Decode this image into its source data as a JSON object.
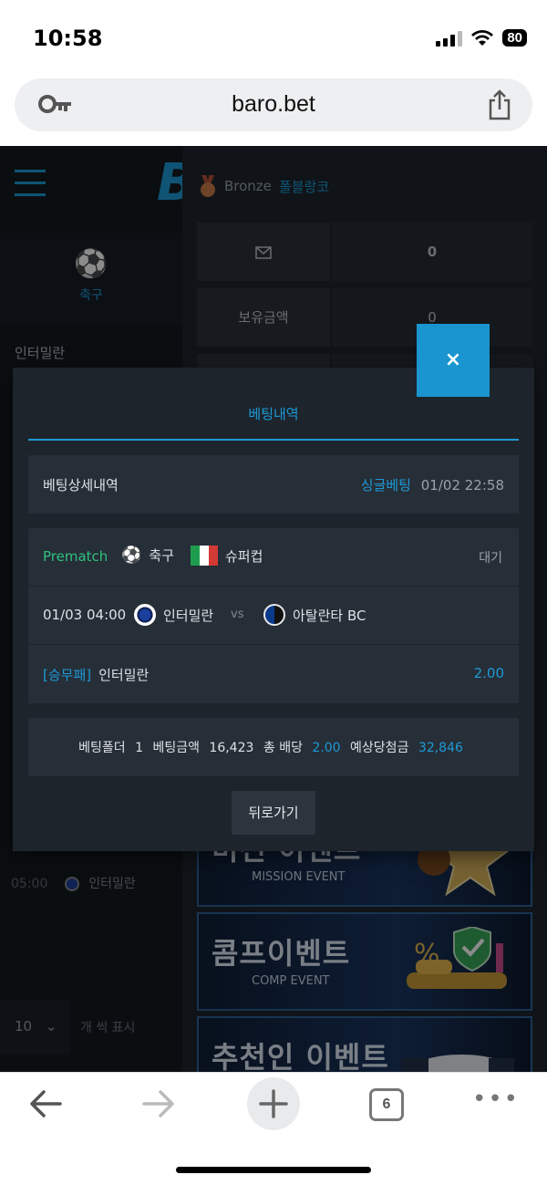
{
  "status_bar": {
    "time": "10:58",
    "battery": "80"
  },
  "browser": {
    "url": "baro.bet",
    "tab_count": "6"
  },
  "background": {
    "sport_label": "축구",
    "team_line": "인터밀란",
    "row_time": "05:00",
    "row_team": "인터밀란",
    "page_size": "10",
    "page_size_label": "개 씩 표시",
    "tier": "Bronze",
    "nickname": "폴블랑코",
    "mail_count": "0",
    "balance_label": "보유금액",
    "balance_value": "0",
    "banners": [
      {
        "title": "미션 이벤트",
        "sub": "MISSION EVENT"
      },
      {
        "title": "콤프이벤트",
        "sub": "COMP EVENT"
      },
      {
        "title": "추천인 이벤트",
        "sub": ""
      }
    ]
  },
  "modal": {
    "title": "베팅내역",
    "close_label": "×",
    "detail_label": "베팅상세내역",
    "bet_type": "싱글베팅",
    "bet_time": "01/02 22:58",
    "match": {
      "mode": "Prematch",
      "sport": "축구",
      "league": "슈퍼컵",
      "status": "대기",
      "date": "01/03 04:00",
      "home": "인터밀란",
      "vs": "vs",
      "away": "아탈란타 BC",
      "market": "[승무패]",
      "pick": "인터밀란",
      "odds": "2.00"
    },
    "summary": {
      "folder_label": "베팅폴더",
      "folder_value": "1",
      "amount_label": "베팅금액",
      "amount_value": "16,423",
      "odds_label": "총 배당",
      "odds_value": "2.00",
      "payout_label": "예상당첨금",
      "payout_value": "32,846"
    },
    "back_label": "뒤로가기"
  },
  "colors": {
    "accent": "#1d9ad6",
    "prematch": "#2ec27e",
    "modal_bg": "#1d242c",
    "card_bg": "#262e37"
  }
}
